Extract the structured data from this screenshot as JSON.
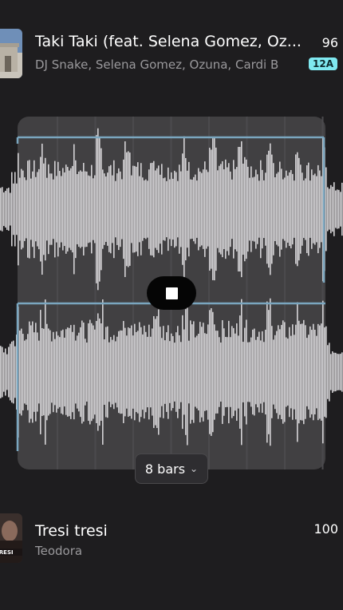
{
  "tracks": [
    {
      "title": "Taki Taki (feat. Selena Gomez, Oz...",
      "artist": "DJ Snake, Selena Gomez, Ozuna, Cardi B",
      "bpm": "96",
      "key": "12A"
    },
    {
      "title": "Tresi tresi",
      "artist": "Teodora",
      "bpm": "100"
    }
  ],
  "loop_selector": {
    "label": "8 bars"
  },
  "colors": {
    "accent_key": "#7fe8f0",
    "loop_region": "#414042",
    "waveform": "#d4d3d6",
    "loop_edge": "#7aa6bf"
  }
}
